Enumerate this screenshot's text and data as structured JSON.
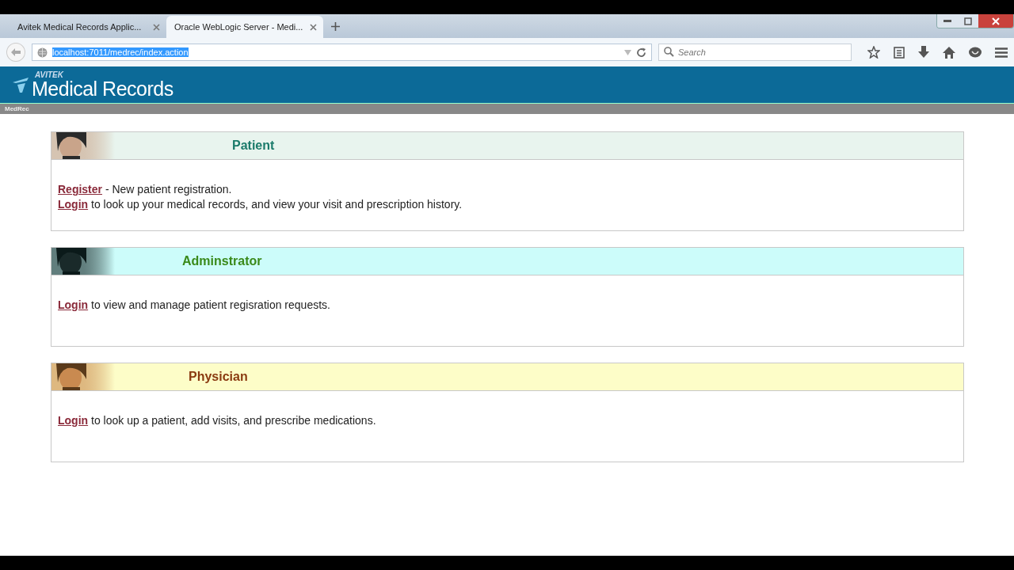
{
  "browser": {
    "tabs": [
      {
        "title": "Avitek Medical Records Applic...",
        "selected": false
      },
      {
        "title": "Oracle WebLogic Server - Medi...",
        "selected": true
      }
    ],
    "address": {
      "value": "localhost:7011/medrec/index.action",
      "highlighted": true
    },
    "search": {
      "placeholder": "Search"
    }
  },
  "header": {
    "brand": "AVITEK",
    "title": "Medical Records"
  },
  "breadcrumb": "MedRec",
  "panels": [
    {
      "kind": "patient",
      "title": "Patient",
      "color": "#1a7a6a",
      "lines": [
        {
          "link": "Register",
          "text": " - New patient registration."
        },
        {
          "link": "Login",
          "text": " to look up your medical records, and view your visit and prescription history."
        }
      ]
    },
    {
      "kind": "admin",
      "title": "Adminstrator",
      "color": "#3a8a1a",
      "lines": [
        {
          "link": "Login",
          "text": " to view and manage patient regisration requests."
        }
      ]
    },
    {
      "kind": "physician",
      "title": "Physician",
      "color": "#8a3a10",
      "lines": [
        {
          "link": "Login",
          "text": " to look up a patient, add visits, and prescribe medications."
        }
      ]
    }
  ]
}
